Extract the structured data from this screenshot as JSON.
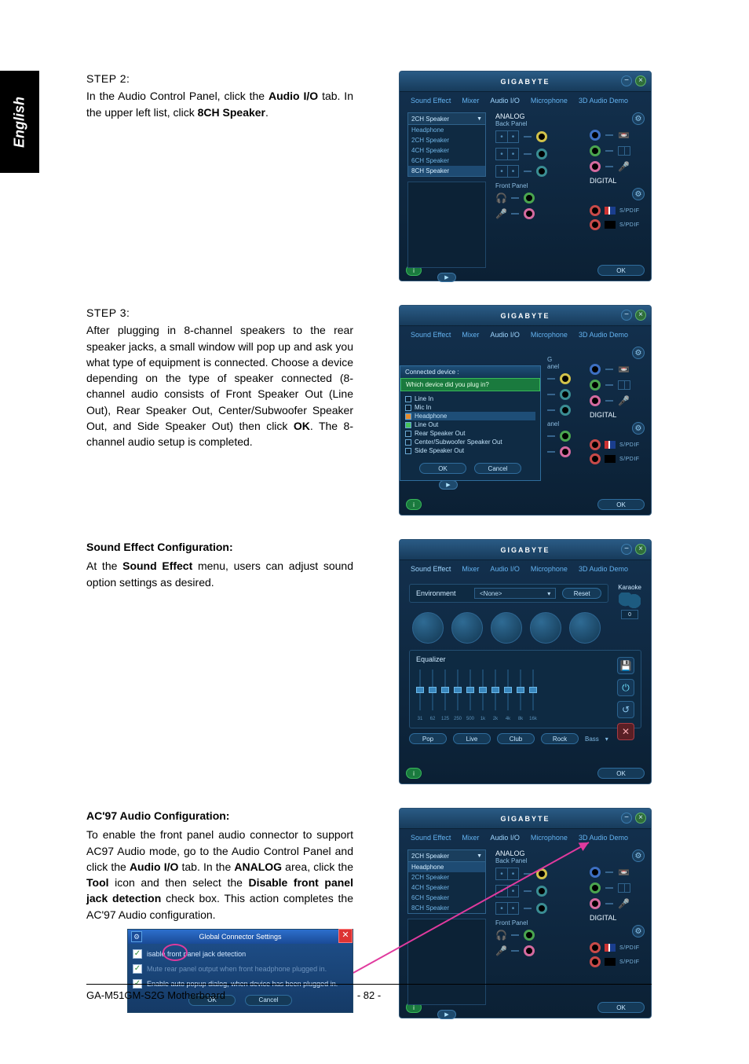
{
  "lang_tab": "English",
  "step2": {
    "title": "STEP 2:",
    "line": "In the Audio Control Panel, click the ",
    "b1": "Audio I/O",
    "line2": " tab. In the upper left list, click ",
    "b2": "8CH Speaker",
    "line3": "."
  },
  "step3": {
    "title": "STEP 3:",
    "body_a": "After plugging in 8-channel speakers to the rear speaker jacks, a small window will pop up and ask you what type of equipment is connected. Choose a device depending on the type of speaker connected (8-channel audio consists of Front Speaker Out (Line Out), Rear Speaker Out, Center/Subwoofer Speaker Out, and Side Speaker Out) then click ",
    "b1": "OK",
    "body_b": ". The 8-channel audio setup is completed."
  },
  "sfx": {
    "title": "Sound Effect Configuration:",
    "l1": "At the ",
    "b1": "Sound Effect",
    "l2": " menu, users can adjust sound option settings as desired."
  },
  "ac97": {
    "title": "AC'97 Audio Configuration:",
    "l1": "To enable the front panel audio connector to support AC97 Audio mode, go to the Audio Control Panel and click the ",
    "b1": "Audio I/O",
    "l2": " tab. In the ",
    "b2": "ANALOG",
    "l3": " area, click the ",
    "b3": "Tool",
    "l4": " icon and then select the ",
    "b4": "Disable front panel jack detection",
    "l5": " check box. This action completes the AC'97 Audio configuration."
  },
  "panel": {
    "brand": "GIGABYTE",
    "tabs": [
      "Sound Effect",
      "Mixer",
      "Audio I/O",
      "Microphone",
      "3D Audio Demo"
    ],
    "info": "i",
    "ok": "OK",
    "cancel": "Cancel"
  },
  "audioio": {
    "dd_value": "2CH Speaker",
    "dd_items": [
      "Headphone",
      "2CH Speaker",
      "4CH Speaker",
      "6CH Speaker",
      "8CH Speaker"
    ],
    "analog": "ANALOG",
    "back_panel": "Back Panel",
    "front_panel": "Front Panel",
    "digital": "DIGITAL",
    "spdif": "S/PDIF"
  },
  "popup": {
    "bar": "Connected device :",
    "q": "Which device did you plug in?",
    "opts": [
      "Line In",
      "Mic In",
      "Headphone",
      "Line Out",
      "Rear Speaker Out",
      "Center/Subwoofer Speaker Out",
      "Side Speaker Out"
    ]
  },
  "sfx_panel": {
    "environment": "Environment",
    "env_value": "<None>",
    "reset": "Reset",
    "karaoke": "Karaoke",
    "kval": "0",
    "equalizer": "Equalizer",
    "eq_ticks": [
      "31",
      "62",
      "125",
      "250",
      "500",
      "1k",
      "2k",
      "4k",
      "8k",
      "16k"
    ],
    "presets": [
      "Pop",
      "Live",
      "Club",
      "Rock"
    ],
    "preset_plain": "Bass"
  },
  "dlg": {
    "title": "Global Connector Settings",
    "c1": "isable front panel jack detection",
    "c2": "Mute rear panel output when front headphone plugged in.",
    "c3": "Enable auto popup dialog, when device has been plugged in."
  },
  "footer": {
    "left": "GA-M51GM-S2G Motherboard",
    "center": "- 82 -"
  }
}
